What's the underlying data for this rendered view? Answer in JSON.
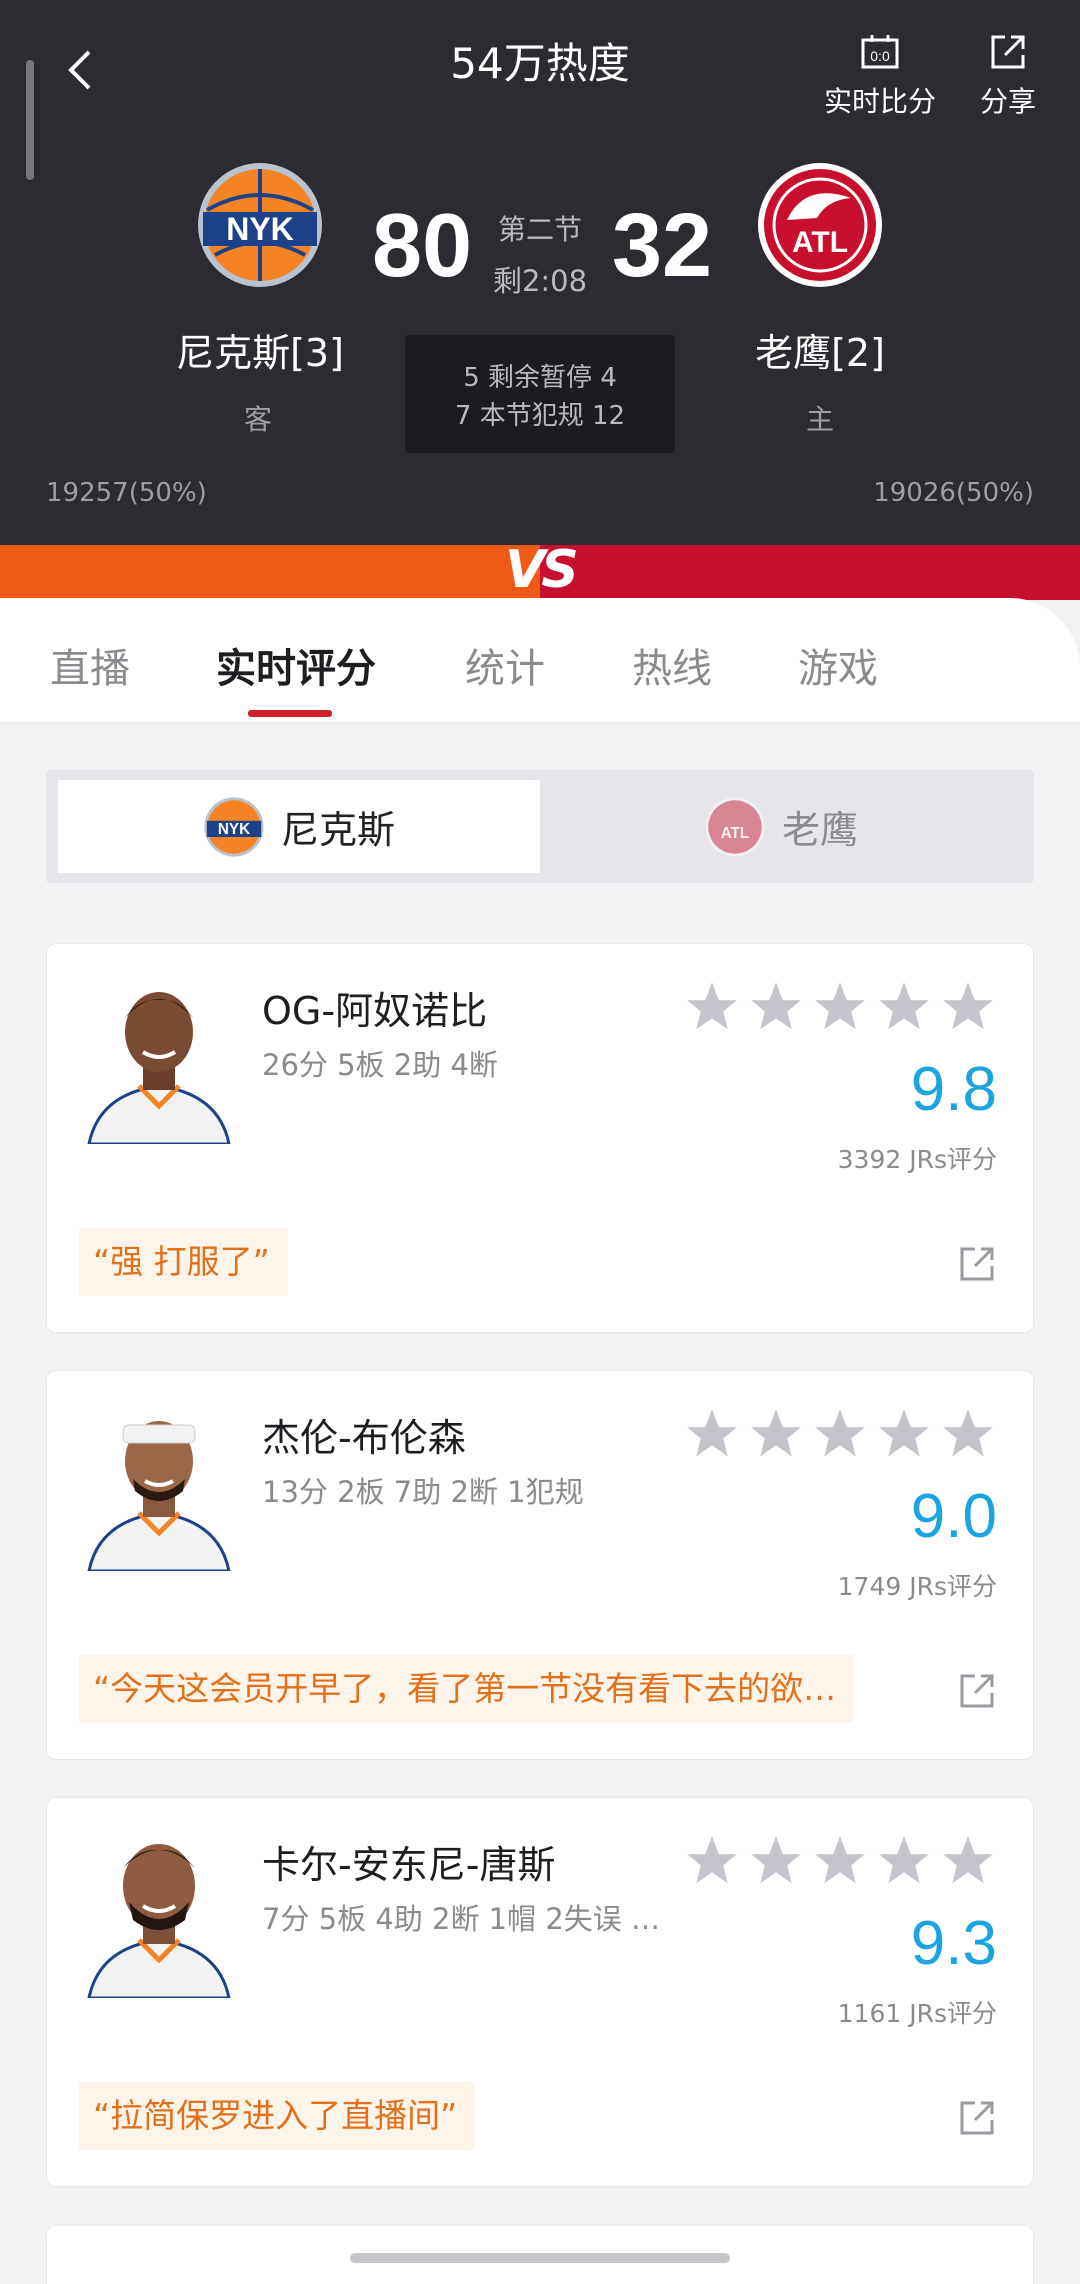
{
  "header": {
    "title": "54万热度",
    "realtime_score_label": "实时比分",
    "share_label": "分享",
    "scoreboard_icon_text": "0:0"
  },
  "game": {
    "away": {
      "name": "尼克斯[3]",
      "score": "80",
      "side": "客",
      "support": "19257(50%)",
      "logo_text": "NYK",
      "color": "#f58426"
    },
    "home": {
      "name": "老鹰[2]",
      "score": "32",
      "side": "主",
      "support": "19026(50%)",
      "logo_text": "ATL",
      "color": "#c8102e"
    },
    "period": "第二节",
    "clock": "剩2:08",
    "timeouts_line": "5 剩余暂停 4",
    "fouls_line": "7 本节犯规 12"
  },
  "vs_label": "VS",
  "tabs": [
    "直播",
    "实时评分",
    "统计",
    "热线",
    "游戏"
  ],
  "team_toggle": {
    "nyk": "尼克斯",
    "atl": "老鹰"
  },
  "players": [
    {
      "name": "OG-阿奴诺比",
      "stats": "26分 5板 2助 4断",
      "rating": "9.8",
      "votes": "3392 JRs评分",
      "comment": "“强 打服了”"
    },
    {
      "name": "杰伦-布伦森",
      "stats": "13分 2板 7助 2断 1犯规",
      "rating": "9.0",
      "votes": "1749 JRs评分",
      "comment": "“今天这会员开早了，看了第一节没有看下去的欲…"
    },
    {
      "name": "卡尔-安东尼-唐斯",
      "stats": "7分 5板 4助 2断 1帽 2失误 …",
      "rating": "9.3",
      "votes": "1161 JRs评分",
      "comment": "“拉简保罗进入了直播间”"
    }
  ],
  "colors": {
    "accent_red": "#d0202e",
    "rating_blue": "#1aa5e0",
    "comment_orange": "#e2701b"
  }
}
